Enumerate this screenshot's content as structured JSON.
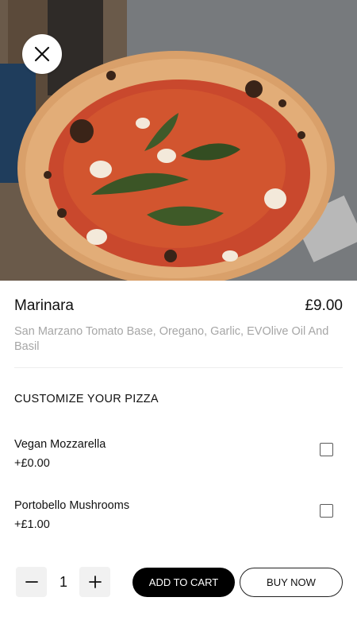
{
  "hero": {
    "image": "pizza-marinara-photo"
  },
  "close": {
    "icon": "close-icon"
  },
  "product": {
    "name": "Marinara",
    "price": "£9.00",
    "description": "San Marzano Tomato Base, Oregano, Garlic, EVOlive Oil And Basil"
  },
  "customize": {
    "title": "CUSTOMIZE YOUR PIZZA",
    "options": [
      {
        "label": "Vegan Mozzarella",
        "price": "+£0.00",
        "checked": false
      },
      {
        "label": "Portobello Mushrooms",
        "price": "+£1.00",
        "checked": false
      }
    ]
  },
  "quantity": {
    "value": "1",
    "decrease_icon": "minus-icon",
    "increase_icon": "plus-icon"
  },
  "actions": {
    "add_to_cart": "ADD TO CART",
    "buy_now": "BUY NOW"
  },
  "colors": {
    "primary_button": "#000000",
    "secondary_button_border": "#222222",
    "muted_text": "#a6a6a6"
  }
}
